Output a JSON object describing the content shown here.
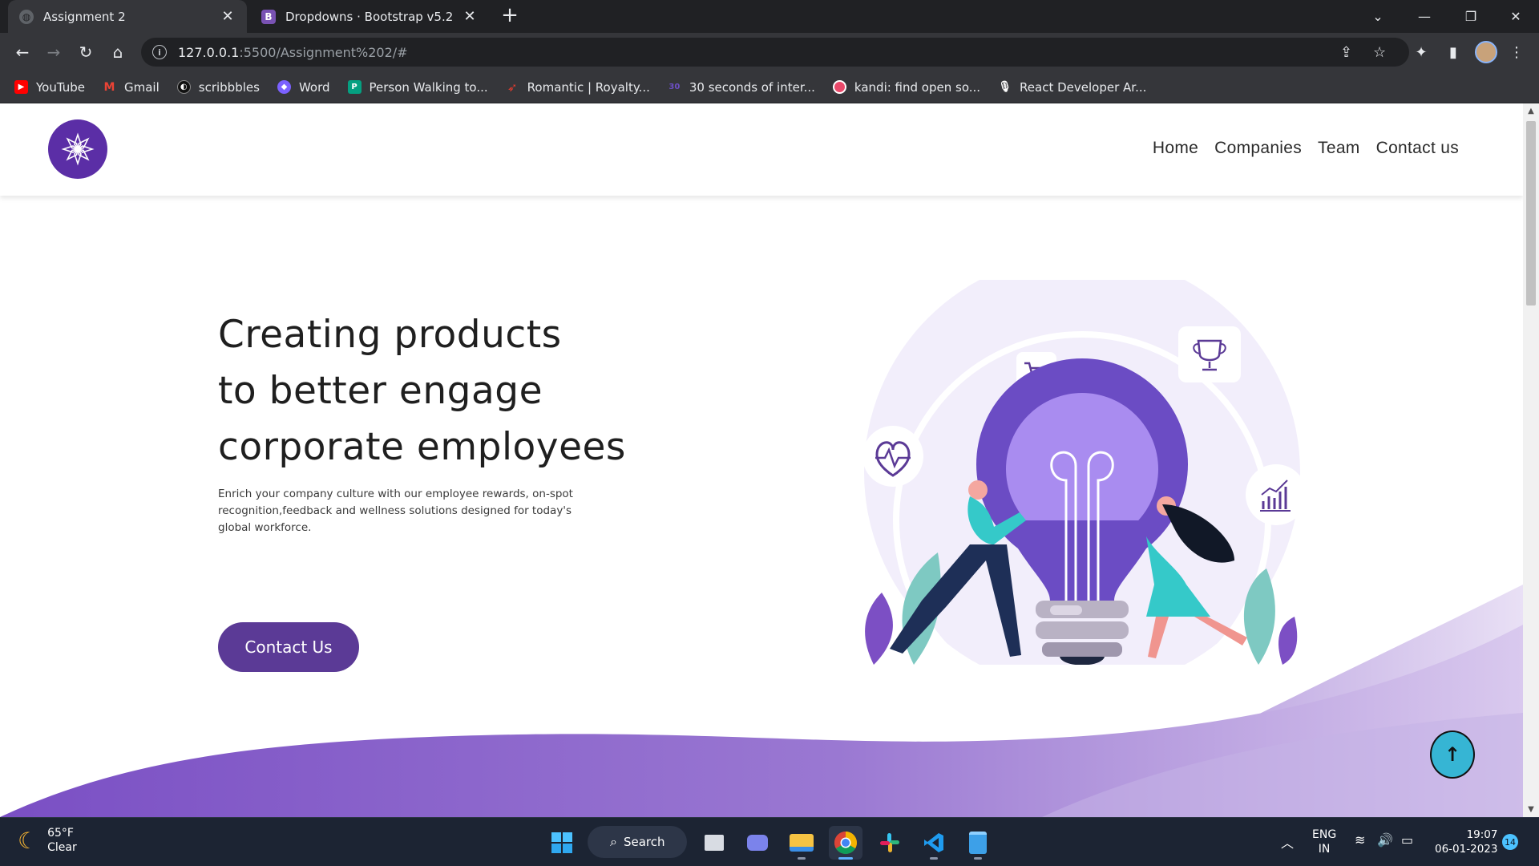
{
  "browser": {
    "tabs": [
      {
        "title": "Assignment 2",
        "active": true
      },
      {
        "title": "Dropdowns · Bootstrap v5.2",
        "active": false,
        "favicon_letter": "B"
      }
    ],
    "url_host": "127.0.0.1",
    "url_path": ":5500/Assignment%202/#",
    "bookmarks": [
      {
        "label": "YouTube",
        "icon": "youtube-icon",
        "color": "#ff0000"
      },
      {
        "label": "Gmail",
        "icon": "gmail-icon",
        "color": "#ea4335"
      },
      {
        "label": "scribbbles",
        "icon": "scribbbles-icon",
        "color": "#333333"
      },
      {
        "label": "Word",
        "icon": "word-icon",
        "color": "#7b61ff"
      },
      {
        "label": "Person Walking to...",
        "icon": "pexels-icon",
        "color": "#05a081"
      },
      {
        "label": "Romantic | Royalty...",
        "icon": "feather-icon",
        "color": "#e23b2e"
      },
      {
        "label": "30 seconds of inter...",
        "icon": "30s-icon",
        "color": "#6c4fc4"
      },
      {
        "label": "kandi: find open so...",
        "icon": "kandi-icon",
        "color": "#e9496a"
      },
      {
        "label": "React Developer Ar...",
        "icon": "react-mic-icon",
        "color": "#ffffff"
      }
    ]
  },
  "site": {
    "nav": [
      "Home",
      "Companies",
      "Team",
      "Contact us"
    ],
    "hero": {
      "title_lines": [
        "Creating products",
        "to better engage",
        "corporate employees"
      ],
      "subtitle": "Enrich your company culture with our employee rewards, on-spot recognition,feedback and wellness solutions designed for today's global workforce.",
      "cta": "Contact Us"
    },
    "back_to_top": "↑",
    "colors": {
      "brand": "#5b2ea6",
      "cta": "#5b3a96",
      "wave": "#8d62c9",
      "back_to_top": "#36b5d4"
    }
  },
  "taskbar": {
    "weather_temp": "65°F",
    "weather_desc": "Clear",
    "search_label": "Search",
    "lang_1": "ENG",
    "lang_2": "IN",
    "time": "19:07",
    "date": "06-01-2023",
    "notifications": "14"
  }
}
